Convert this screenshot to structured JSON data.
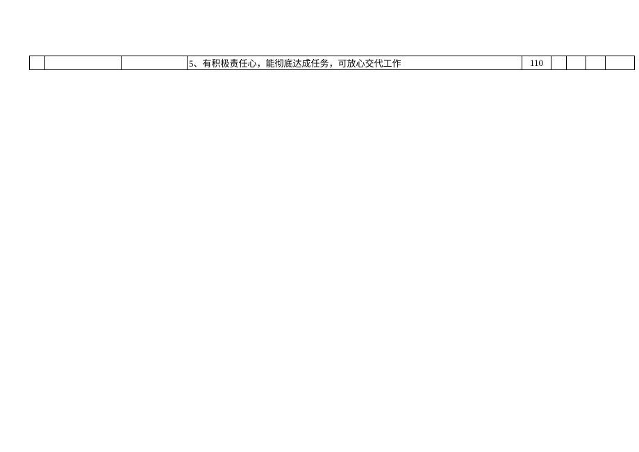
{
  "row": {
    "col1": "",
    "col2": "",
    "col3": "",
    "description": "5、有积极责任心，能彻底达成任务，可放心交代工作",
    "score": "110",
    "col6": "",
    "col7": "",
    "col8": "",
    "col9": ""
  }
}
